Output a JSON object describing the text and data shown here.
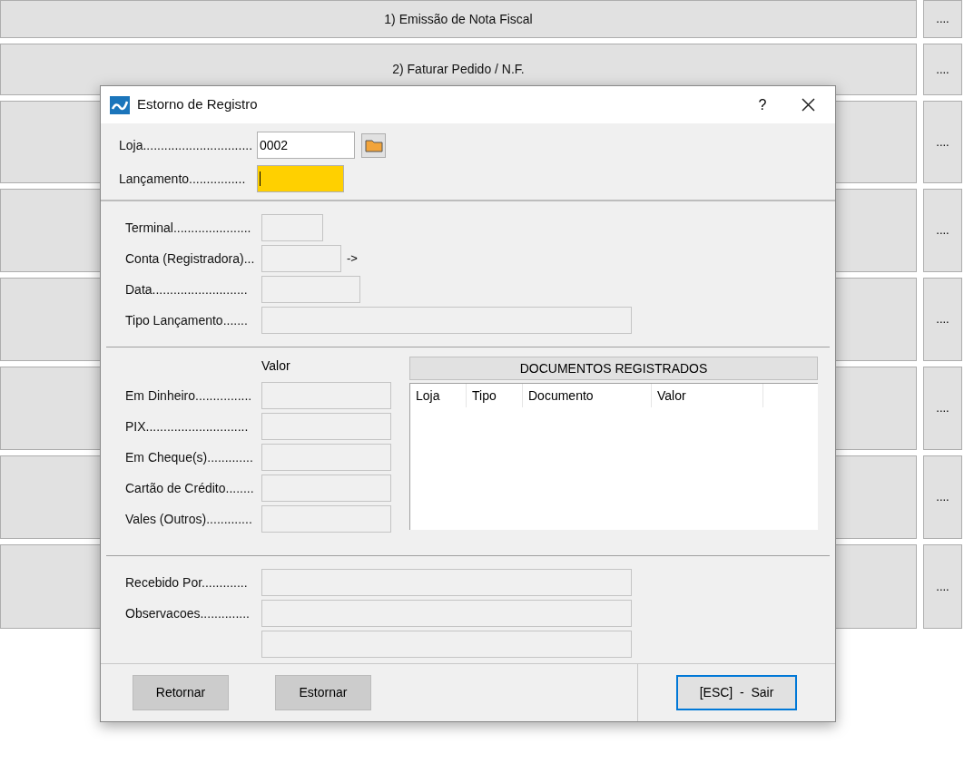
{
  "background_menu": {
    "rows": [
      {
        "label": "1) Emissão de Nota Fiscal",
        "more": "...."
      },
      {
        "label": "2) Faturar Pedido / N.F.",
        "more": "...."
      },
      {
        "more": "...."
      },
      {
        "more": "...."
      },
      {
        "more": "...."
      },
      {
        "more": "...."
      },
      {
        "more": "...."
      },
      {
        "more": "...."
      }
    ]
  },
  "dialog": {
    "title": "Estorno de Registro",
    "help": "?",
    "header_fields": [
      {
        "label": "Loja...............................",
        "value": "0002",
        "focused": false,
        "lookup": true
      },
      {
        "label": "Lançamento................",
        "focused": true,
        "lookup": false
      }
    ],
    "info_fields": [
      {
        "label": "Terminal......................"
      },
      {
        "label": "Conta (Registradora)...",
        "suffix": "->"
      },
      {
        "label": "Data..........................."
      },
      {
        "label": "Tipo Lançamento......."
      }
    ],
    "values": {
      "heading": "Valor",
      "fields": [
        {
          "label": "Em Dinheiro................"
        },
        {
          "label": "PIX............................."
        },
        {
          "label": "Em Cheque(s)............."
        },
        {
          "label": "Cartão de Crédito........"
        },
        {
          "label": "Vales (Outros)............."
        }
      ]
    },
    "documents": {
      "title": "DOCUMENTOS REGISTRADOS",
      "columns": [
        "Loja",
        "Tipo",
        "Documento",
        "Valor"
      ]
    },
    "notes_fields": [
      {
        "kind": "labeled",
        "label": "Recebido Por............."
      },
      {
        "kind": "labeled",
        "label": "Observacoes.............."
      },
      {
        "kind": "continuation"
      }
    ],
    "buttons": [
      {
        "label": "Retornar",
        "default": false
      },
      {
        "label": "Estornar",
        "default": false
      },
      {
        "label": "[ESC]  -  Sair",
        "default": true
      }
    ]
  }
}
